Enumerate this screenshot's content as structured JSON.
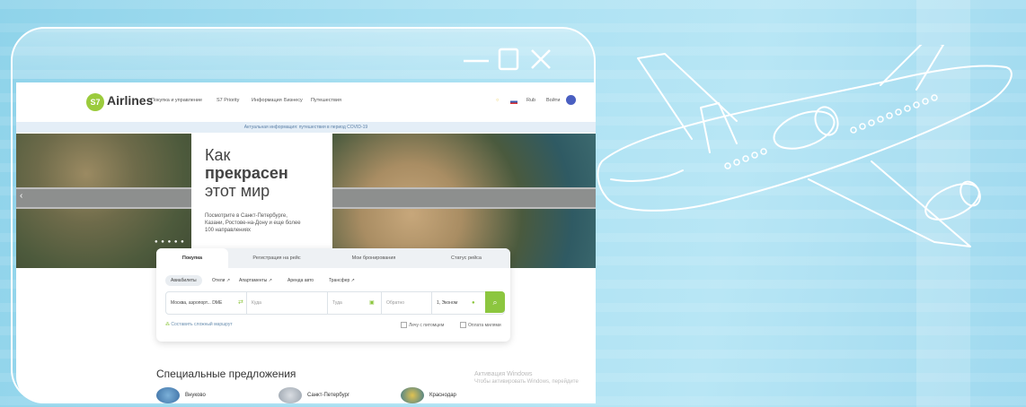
{
  "window": {
    "controls": [
      "minimize-icon",
      "maximize-icon",
      "close-icon"
    ]
  },
  "nav": {
    "logo_mark": "S7",
    "logo_text": "Airlines",
    "items": [
      "Покупка и управление",
      "S7 Priority",
      "Информация",
      "Бизнесу",
      "Путешествия"
    ],
    "right": {
      "currency": "Rub",
      "login": "Войти"
    }
  },
  "notice": "Актуальная информация: путешествия в период COVID-19",
  "hero": {
    "title_line1": "Как",
    "title_line2": "прекрасен",
    "title_line3": "этот мир",
    "subtitle": "Посмотрите в Санкт-Петербурге, Казани, Ростове-на-Дону и еще более 100 направлениях"
  },
  "search": {
    "tabs": [
      "Покупка",
      "Регистрация на рейс",
      "Мои бронирования",
      "Статус рейса"
    ],
    "pills": [
      "Авиабилеты",
      "Отели ↗",
      "Апартаменты ↗",
      "Аренда авто",
      "Трансфер ↗"
    ],
    "from": "Москва, аэропорт... DME",
    "to": "Куда",
    "depart": "Туда",
    "return": "Обратно",
    "passengers": "1, Эконом",
    "complex_route": "Составить сложный маршрут",
    "check_pet": "Лечу с питомцем",
    "check_miles": "Оплата милями"
  },
  "special": {
    "title": "Специальные предложения",
    "offers": [
      "Внуково",
      "Санкт-Петербург",
      "Краснодар"
    ]
  },
  "watermark": {
    "line1": "Активация Windows",
    "line2": "Чтобы активировать Windows, перейдите"
  },
  "colors": {
    "brand_green": "#8cc63f",
    "frame": "#ffffff",
    "bg": "#a9e0f2"
  }
}
